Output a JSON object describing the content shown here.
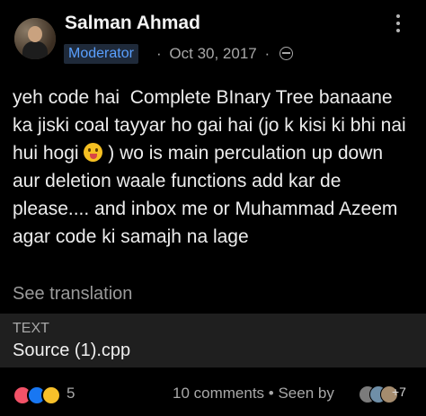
{
  "post": {
    "author_name": "Salman Ahmad",
    "author_badge": "Moderator",
    "date": "Oct 30, 2017",
    "separator": "·",
    "menu_icon": "more-options-icon",
    "text_before_emoji": "yeh code hai  Complete BInary Tree banaane ka jiski coal tayyar ho gai hai (jo k kisi ki bhi nai hui hogi ",
    "emoji_icon": "tongue-out-emoji-icon",
    "text_after_emoji": " ) wo is main perculation up down aur deletion waale functions add kar de please.... and inbox me or Muhammad Azeem agar code ki samajh na lage",
    "see_translation": "See translation"
  },
  "attachment": {
    "type_label": "TEXT",
    "file_name": "Source (1).cpp"
  },
  "footer": {
    "reaction_icons": [
      "love-reaction-icon",
      "like-reaction-icon",
      "haha-reaction-icon"
    ],
    "reaction_count": "5",
    "comments_text": "10 comments",
    "seen_text": "Seen by",
    "seen_extra": "+7"
  },
  "colors": {
    "background": "#000000",
    "badge_text": "#5aa0ff",
    "badge_bg": "#1f2a3a",
    "attachment_bg": "#1f1f1f"
  }
}
